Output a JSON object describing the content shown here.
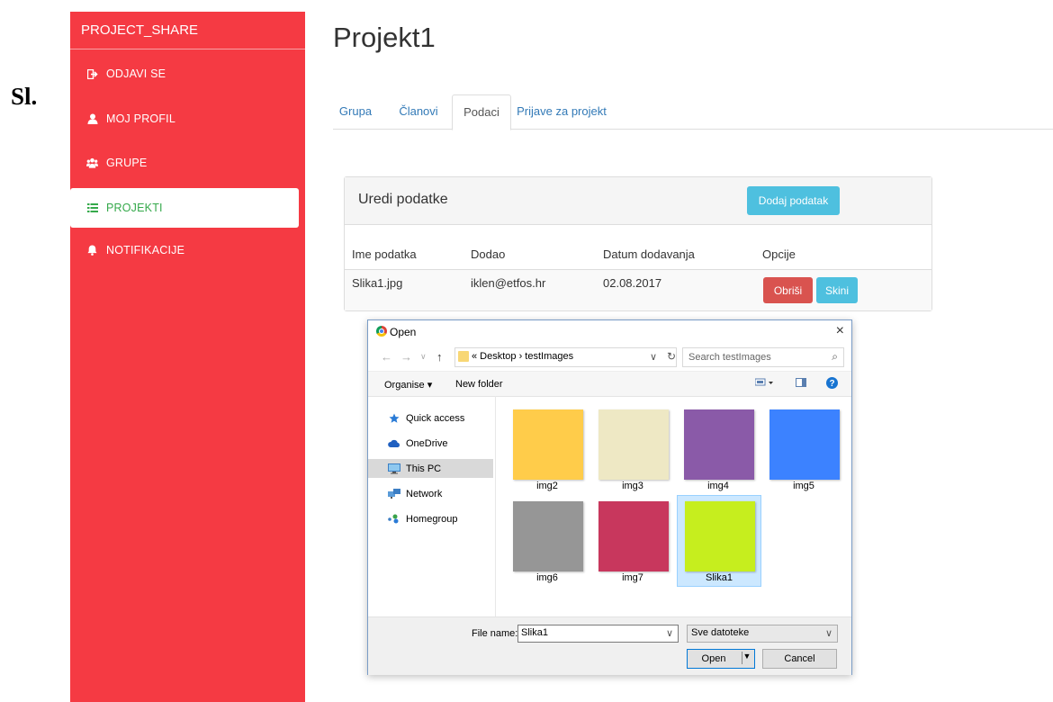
{
  "side_label": "Sl.",
  "sidebar": {
    "brand": "PROJECT_SHARE",
    "items": [
      {
        "label": "ODJAVI SE",
        "icon": "sign-out-icon"
      },
      {
        "label": "MOJ PROFIL",
        "icon": "user-icon"
      },
      {
        "label": "GRUPE",
        "icon": "users-icon"
      },
      {
        "label": "PROJEKTI",
        "icon": "list-icon",
        "active": true
      },
      {
        "label": "NOTIFIKACIJE",
        "icon": "bell-icon"
      }
    ]
  },
  "page": {
    "title": "Projekt1",
    "tabs": [
      "Grupa",
      "Članovi",
      "Podaci",
      "Prijave za projekt"
    ],
    "active_tab": "Podaci"
  },
  "panel": {
    "title": "Uredi podatke",
    "add_button": "Dodaj podatak",
    "columns": [
      "Ime podatka",
      "Dodao",
      "Datum dodavanja",
      "Opcije"
    ],
    "rows": [
      {
        "name": "Slika1.jpg",
        "added_by": "iklen@etfos.hr",
        "date": "02.08.2017",
        "delete": "Obriši",
        "download": "Skini"
      }
    ]
  },
  "dialog": {
    "title": "Open",
    "close": "×",
    "nav": {
      "back": "←",
      "forward": "→",
      "recent": "∨",
      "up": "↑"
    },
    "path": "« Desktop › testImages",
    "search_placeholder": "Search testImages",
    "toolbar": {
      "organise": "Organise ▾",
      "new_folder": "New folder"
    },
    "left_nav": [
      {
        "label": "Quick access",
        "icon": "star-icon"
      },
      {
        "label": "OneDrive",
        "icon": "cloud-icon"
      },
      {
        "label": "This PC",
        "icon": "computer-icon",
        "selected": true
      },
      {
        "label": "Network",
        "icon": "network-icon"
      },
      {
        "label": "Homegroup",
        "icon": "homegroup-icon"
      }
    ],
    "files": [
      {
        "name": "img2",
        "color": "#ffcc4a"
      },
      {
        "name": "img3",
        "color": "#eee8c4"
      },
      {
        "name": "img4",
        "color": "#8a5aa8"
      },
      {
        "name": "img5",
        "color": "#3c82ff"
      },
      {
        "name": "img6",
        "color": "#969696"
      },
      {
        "name": "img7",
        "color": "#c8375d"
      },
      {
        "name": "Slika1",
        "color": "#c6ee1e",
        "selected": true
      }
    ],
    "file_name_label": "File name:",
    "file_name_value": "Slika1",
    "filter": "Sve datoteke",
    "open_label": "Open",
    "cancel_label": "Cancel"
  },
  "colors": {
    "sidebar": "#f53a43",
    "active_nav_text": "#35a94b",
    "info_button": "#4ec0df",
    "danger_button": "#d9534f",
    "link": "#337ab7"
  }
}
